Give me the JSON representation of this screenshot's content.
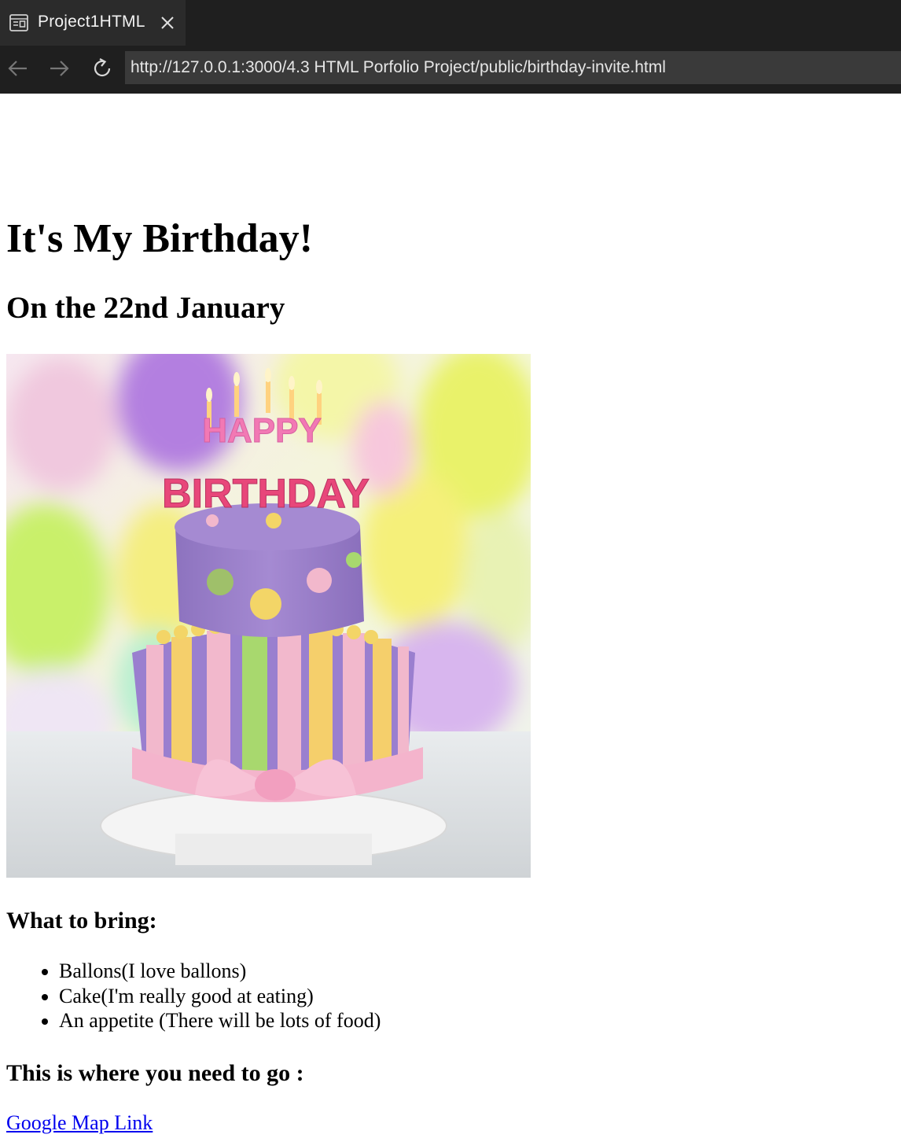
{
  "browser": {
    "tab": {
      "title": "Project1HTML",
      "icon": "browser-window-icon",
      "close_icon": "close-icon"
    },
    "nav": {
      "back_icon": "arrow-left-icon",
      "forward_icon": "arrow-right-icon",
      "reload_icon": "reload-icon"
    },
    "url": "http://127.0.0.1:3000/4.3 HTML Porfolio Project/public/birthday-invite.html",
    "colors": {
      "chrome_bg": "#1f1f1f",
      "tab_bg": "#2b2b2b",
      "url_bg": "#3a3a3a"
    }
  },
  "page": {
    "title": "It's My Birthday!",
    "date_heading": "On the 22nd January",
    "image": {
      "topper_line1": "HAPPY",
      "topper_line2": "BIRTHDAY"
    },
    "bring_heading": "What to bring:",
    "bring_items": [
      "Ballons(I love ballons)",
      "Cake(I'm really good at eating)",
      "An appetite (There will be lots of food)"
    ],
    "go_heading": "This is where you need to go :",
    "map_link": "Google Map Link",
    "link_color": "#0000ee"
  }
}
